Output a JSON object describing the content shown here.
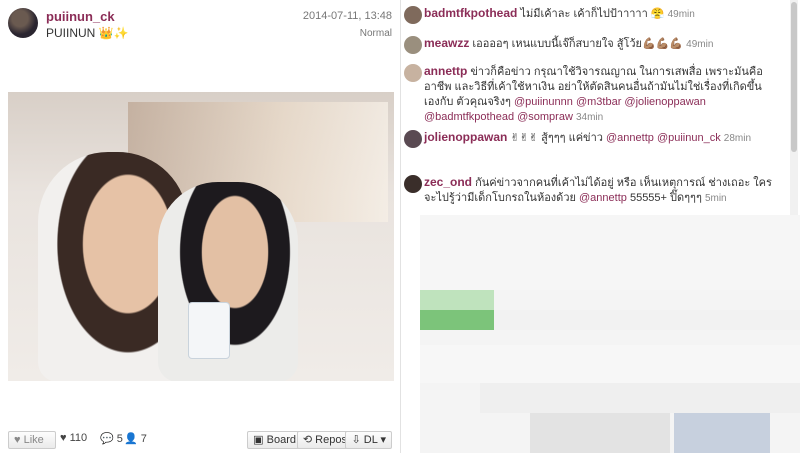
{
  "post": {
    "username": "puiinun_ck",
    "caption": "PUIINUN",
    "caption_emoji": "👑✨",
    "date": "2014-07-11, 13:48",
    "filter": "Normal",
    "actions": {
      "like_label": "Like",
      "likes": "110",
      "comments": "5",
      "reposts": "7",
      "board_label": "Board",
      "repost_label": "Repost",
      "dl_label": "DL"
    }
  },
  "comments": [
    {
      "user": "badmtfkpothead",
      "text": "ไม่มีเค้าละ เค้าก็ไปป้าาาาา 😤",
      "time": "49min"
    },
    {
      "user": "meawzz",
      "text": "เออออๆ เหนแบบนี้เจ๊ก็สบายใจ สู้โว้ย💪🏽💪🏽💪🏽",
      "time": "49min"
    },
    {
      "user": "annettp",
      "text": "ข่าวก็คือข่าว กรุณาใช้วิจารณญาณ ในการเสพสื่อ เพราะมันคืออาชีพ และวิธีที่เค้าใช้หาเงิน อย่าให้ตัดสินคนอื่นถ้ามันไม่ใช่เรื่องที่เกิดขึ้นเองกับ ตัวคุณจริงๆ",
      "mentions": "@puiinunnn @m3tbar @jolienoppawan @badmtfkpothead @sompraw",
      "time": "34min"
    },
    {
      "user": "jolienoppawan",
      "text": "✌✌✌ สู้ๆๆๆ แค่ข่าว",
      "mentions_a": "@annettp",
      "mentions_b": "@puiinun_ck",
      "time": "28min"
    },
    {
      "user": "zec_ond",
      "text": "กันค่ข่าวจากคนที่เค้าไม่ได้อยู่ หรือ เห็นเหตุการณ์ ช่างเถอะ ใครจะไปรู้ว่ามีเด็กโบกรถในห้องด้วย",
      "mentions": "@annettp",
      "tail": "55555+ ปิ๊ดๆๆๆ",
      "time": "5min"
    }
  ],
  "colors": {
    "accent": "#8b2d57",
    "border": "#e2e2e2"
  }
}
